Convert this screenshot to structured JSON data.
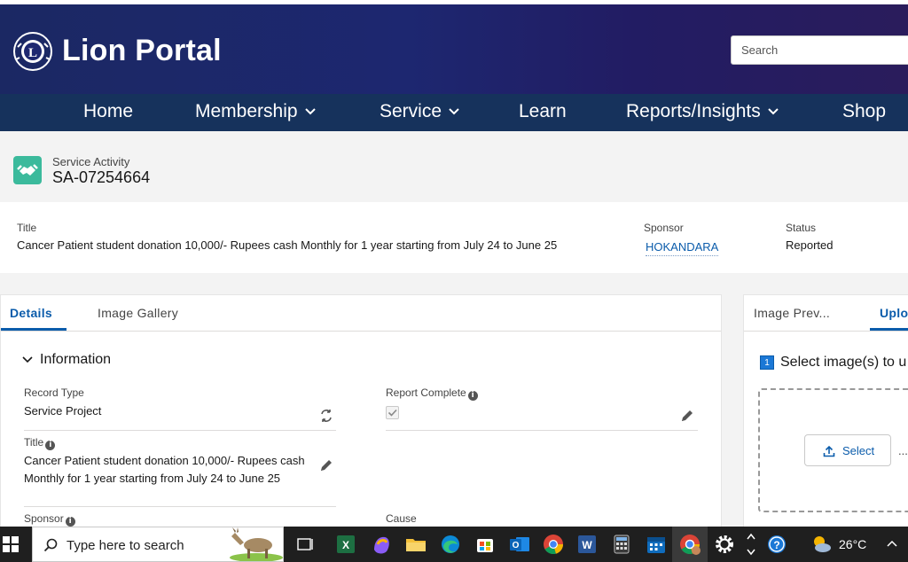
{
  "header": {
    "brand": "Lion Portal",
    "search_placeholder": "Search"
  },
  "nav": {
    "items": [
      {
        "label": "Home",
        "has_dropdown": false
      },
      {
        "label": "Membership",
        "has_dropdown": true
      },
      {
        "label": "Service",
        "has_dropdown": true
      },
      {
        "label": "Learn",
        "has_dropdown": false
      },
      {
        "label": "Reports/Insights",
        "has_dropdown": true
      },
      {
        "label": "Shop",
        "has_dropdown": false
      }
    ]
  },
  "record": {
    "object_label": "Service Activity",
    "name": "SA-07254664",
    "icon": "handshake-icon"
  },
  "highlights": {
    "title_label": "Title",
    "title_value": "Cancer Patient student donation 10,000/- Rupees cash Monthly for 1 year starting from July 24 to June 25",
    "sponsor_label": "Sponsor",
    "sponsor_value": "HOKANDARA",
    "status_label": "Status",
    "status_value": "Reported"
  },
  "detail_tabs": {
    "tabs": [
      "Details",
      "Image Gallery"
    ],
    "active": "Details"
  },
  "information": {
    "section_title": "Information",
    "record_type_label": "Record Type",
    "record_type_value": "Service Project",
    "report_complete_label": "Report Complete",
    "report_complete_checked": true,
    "title_label": "Title",
    "title_value": "Cancer Patient student donation 10,000/- Rupees cash Monthly for 1 year starting from July 24 to June 25",
    "sponsor_label": "Sponsor",
    "cause_label": "Cause"
  },
  "right_panel": {
    "tabs": [
      "Image Prev...",
      "Uplo"
    ],
    "active": "Uplo",
    "step_number": "1",
    "step_text": "Select image(s) to u",
    "select_button": "Select",
    "ellipsis": "..."
  },
  "taskbar": {
    "search_placeholder": "Type here to search",
    "temperature": "26°C",
    "apps": [
      "task-view-icon",
      "excel-icon",
      "copilot-icon",
      "file-explorer-icon",
      "edge-icon",
      "store-icon",
      "outlook-icon",
      "chrome-icon",
      "word-icon",
      "calculator-icon",
      "calendar-icon",
      "chrome-profile-icon",
      "settings-icon"
    ]
  },
  "colors": {
    "nav_bg": "#16325c",
    "header_bg": "#1d2770",
    "brand_link": "#0b5cab",
    "record_icon": "#3bba9c"
  }
}
